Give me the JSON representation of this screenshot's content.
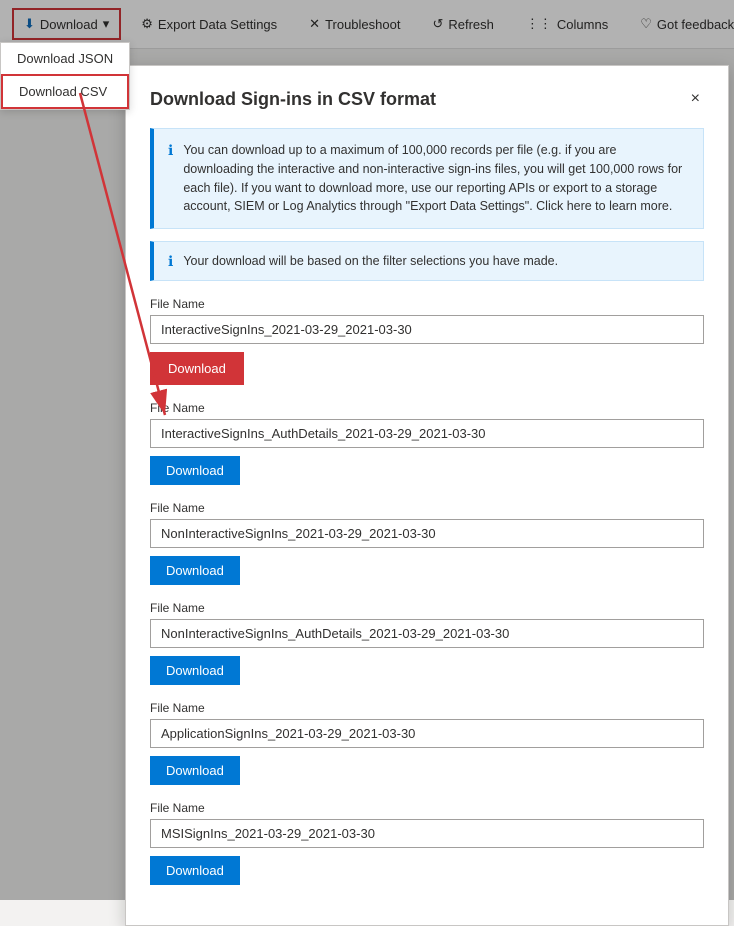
{
  "toolbar": {
    "download_label": "Download",
    "download_chevron": "▾",
    "export_label": "Export Data Settings",
    "troubleshoot_label": "Troubleshoot",
    "refresh_label": "Refresh",
    "columns_label": "Columns",
    "feedback_label": "Got feedback?"
  },
  "dropdown": {
    "items": [
      {
        "id": "json",
        "label": "Download JSON"
      },
      {
        "id": "csv",
        "label": "Download CSV"
      }
    ]
  },
  "modal": {
    "title": "Download Sign-ins in CSV format",
    "close_label": "×",
    "info_main": "You can download up to a maximum of 100,000 records per file (e.g. if you are downloading the interactive and non-interactive sign-ins files, you will get 100,000 rows for each file). If you want to download more, use our reporting APIs or export to a storage account, SIEM or Log Analytics through \"Export Data Settings\". Click here to learn more.",
    "info_filter": "Your download will be based on the filter selections you have made.",
    "files": [
      {
        "label": "File Name",
        "value": "InteractiveSignIns_2021-03-29_2021-03-30",
        "highlighted": true
      },
      {
        "label": "File Name",
        "value": "InteractiveSignIns_AuthDetails_2021-03-29_2021-03-30",
        "highlighted": false
      },
      {
        "label": "File Name",
        "value": "NonInteractiveSignIns_2021-03-29_2021-03-30",
        "highlighted": false
      },
      {
        "label": "File Name",
        "value": "NonInteractiveSignIns_AuthDetails_2021-03-29_2021-03-30",
        "highlighted": false
      },
      {
        "label": "File Name",
        "value": "ApplicationSignIns_2021-03-29_2021-03-30",
        "highlighted": false
      },
      {
        "label": "File Name",
        "value": "MSISignIns_2021-03-29_2021-03-30",
        "highlighted": false
      }
    ],
    "download_btn_label": "Download"
  }
}
